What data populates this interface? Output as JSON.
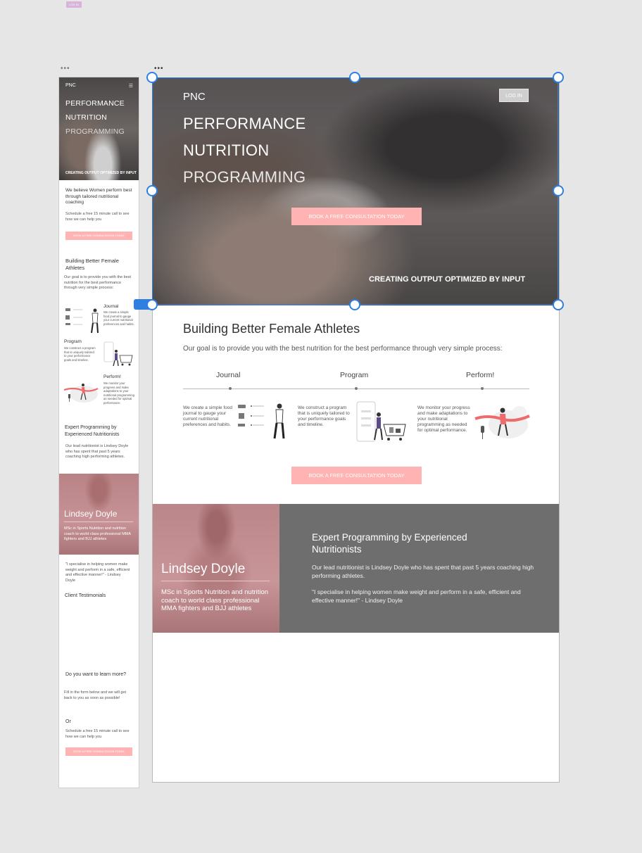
{
  "canvas": {
    "mini_tag": "LOG IN",
    "mobile_dots": "•••",
    "desktop_dots": "•••"
  },
  "mobile": {
    "logo": "PNC",
    "menu_icon": "hamburger-icon",
    "title_line1": "PERFORMANCE",
    "title_line2": "NUTRITION",
    "title_line3": "PROGRAMMING",
    "tagline": "CREATING OUTPUT OPTIMIZED BY INPUT",
    "belief": "We believe Women perform best through tailored nutritional coaching",
    "schedule": "Schedule a free 15 minute call to see how we can help you",
    "cta": "BOOK A FREE CONSULTATION TODAY",
    "section_title": "Building Better Female Athletes",
    "section_intro": "Our goal is to provide you with the best nutrition for the best performance through very simple process:",
    "journal_label": "Journal",
    "journal_text": "We create a simple food journal to gauge your current nutritional preferences and habits.",
    "program_label": "Program",
    "program_text": "We construct a program that is uniquely tailored to your performance goals and timeline.",
    "perform_label": "Perform!",
    "perform_text": "We monitor your progress and make adaptations to your nutritional programming as needed for optimal performance.",
    "expert_title": "Expert Programming by Experienced Nutritionists",
    "expert_text": "Our lead nutritionist is Lindsey Doyle who has spent that past 5 years coaching high performing athletes.",
    "coach_name": "Lindsey Doyle",
    "coach_desc": "MSc in Sports Nutrition and nutrition coach to world class professional MMA fighters and BJJ athletes",
    "quote": "\"I specialise in helping women make weight and perform in a safe, efficient and effective manner!\" - Lindsey Doyle",
    "testimonials": "Client Testimonials",
    "learn_more": "Do you want to learn more?",
    "form_text": "Fill in the form below and we will get back to you as soon as possible!",
    "or": "Or",
    "schedule2": "Schedule a free 15 minute call to see how we can help you",
    "cta2": "BOOK A FREE CONSULTATION TODAY"
  },
  "desktop": {
    "logo": "PNC",
    "login": "LOG IN",
    "title_line1": "PERFORMANCE",
    "title_line2": "NUTRITION",
    "title_line3": "PROGRAMMING",
    "cta": "BOOK A FREE CONSULTATION TODAY",
    "tagline": "CREATING OUTPUT OPTIMIZED BY INPUT",
    "section_title": "Building Better Female Athletes",
    "section_intro": "Our goal is to provide you with the best nutrition for the best performance through very simple process:",
    "steps": [
      {
        "label": "Journal",
        "text": "We create a simple food journal to gauge your current nutritional preferences and habits.",
        "icon": "journal-illustration-icon"
      },
      {
        "label": "Program",
        "text": "We construct a program that is uniquely tailored to your performance goals and timeline.",
        "icon": "shopping-cart-illustration-icon"
      },
      {
        "label": "Perform!",
        "text": "We monitor your progress and make adaptations to your nutritional programming as needed for optimal performance.",
        "icon": "finish-line-illustration-icon"
      }
    ],
    "cta2": "BOOK A FREE CONSULTATION TODAY",
    "coach_name": "Lindsey Doyle",
    "coach_desc": "MSc in Sports Nutrition and nutrition coach to world class professional MMA fighters and BJJ athletes",
    "expert_title": "Expert Programming by Experienced Nutritionists",
    "expert_text": "Our lead nutritionist is Lindsey Doyle who has spent that past 5 years coaching high performing athletes.",
    "quote": "\"I specialise in helping women make weight and perform in a safe, efficient and effective manner!\" - Lindsey Doyle"
  },
  "colors": {
    "canvas_bg": "#e6e6e6",
    "accent_pink": "#ffb3b3",
    "bio_panel": "#6e6e6e",
    "selection_blue": "#2f7fe0"
  }
}
